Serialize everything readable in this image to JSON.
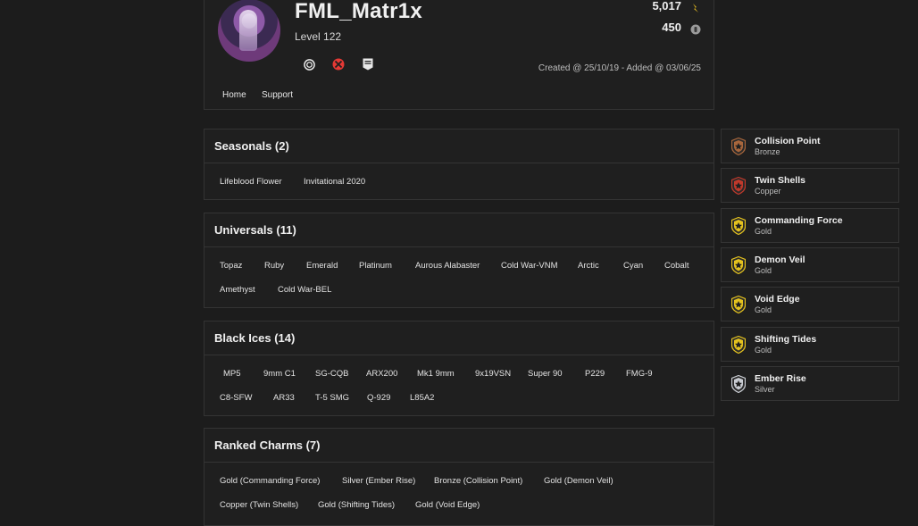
{
  "profile": {
    "username": "FML_Matr1x",
    "level": "Level 122",
    "renown": "5,017",
    "credits": "450",
    "dates": "Created @ 25/10/19 - Added @ 03/06/25",
    "platforms": [
      "ubisoft-icon",
      "xbox-icon",
      "epic-games-icon"
    ],
    "nav": {
      "home": "Home",
      "support": "Support"
    }
  },
  "sections": {
    "seasonals": {
      "title": "Seasonals (2)",
      "items": [
        "Lifeblood Flower",
        "Invitational 2020"
      ]
    },
    "universals": {
      "title": "Universals (11)",
      "items": [
        "Topaz",
        "Ruby",
        "Emerald",
        "Platinum",
        "Aurous Alabaster",
        "Cold War-VNM",
        "Arctic",
        "Cyan",
        "Cobalt",
        "Amethyst",
        "Cold War-BEL"
      ]
    },
    "blackices": {
      "title": "Black Ices (14)",
      "items": [
        "MP5",
        "9mm C1",
        "SG-CQB",
        "ARX200",
        "Mk1 9mm",
        "9x19VSN",
        "Super 90",
        "P229",
        "FMG-9",
        "C8-SFW",
        "AR33",
        "T-5 SMG",
        "Q-929",
        "L85A2"
      ]
    },
    "ranked": {
      "title": "Ranked Charms (7)",
      "items": [
        "Gold (Commanding Force)",
        "Silver (Ember Rise)",
        "Bronze (Collision Point)",
        "Gold (Demon Veil)",
        "Copper (Twin Shells)",
        "Gold (Shifting Tides)",
        "Gold (Void Edge)"
      ]
    }
  },
  "charms": [
    {
      "name": "Collision Point",
      "tier": "Bronze",
      "color": "#a8663c"
    },
    {
      "name": "Twin Shells",
      "tier": "Copper",
      "color": "#c0392b"
    },
    {
      "name": "Commanding Force",
      "tier": "Gold",
      "color": "#e4c21f"
    },
    {
      "name": "Demon Veil",
      "tier": "Gold",
      "color": "#e4c21f"
    },
    {
      "name": "Void Edge",
      "tier": "Gold",
      "color": "#e4c21f"
    },
    {
      "name": "Shifting Tides",
      "tier": "Gold",
      "color": "#e4c21f"
    },
    {
      "name": "Ember Rise",
      "tier": "Silver",
      "color": "#c9ccd2"
    }
  ],
  "colors": {
    "background": "#1c1c1c",
    "panel": "#1f1f1f",
    "border": "#343434",
    "renown_gold": "#e0b820"
  }
}
